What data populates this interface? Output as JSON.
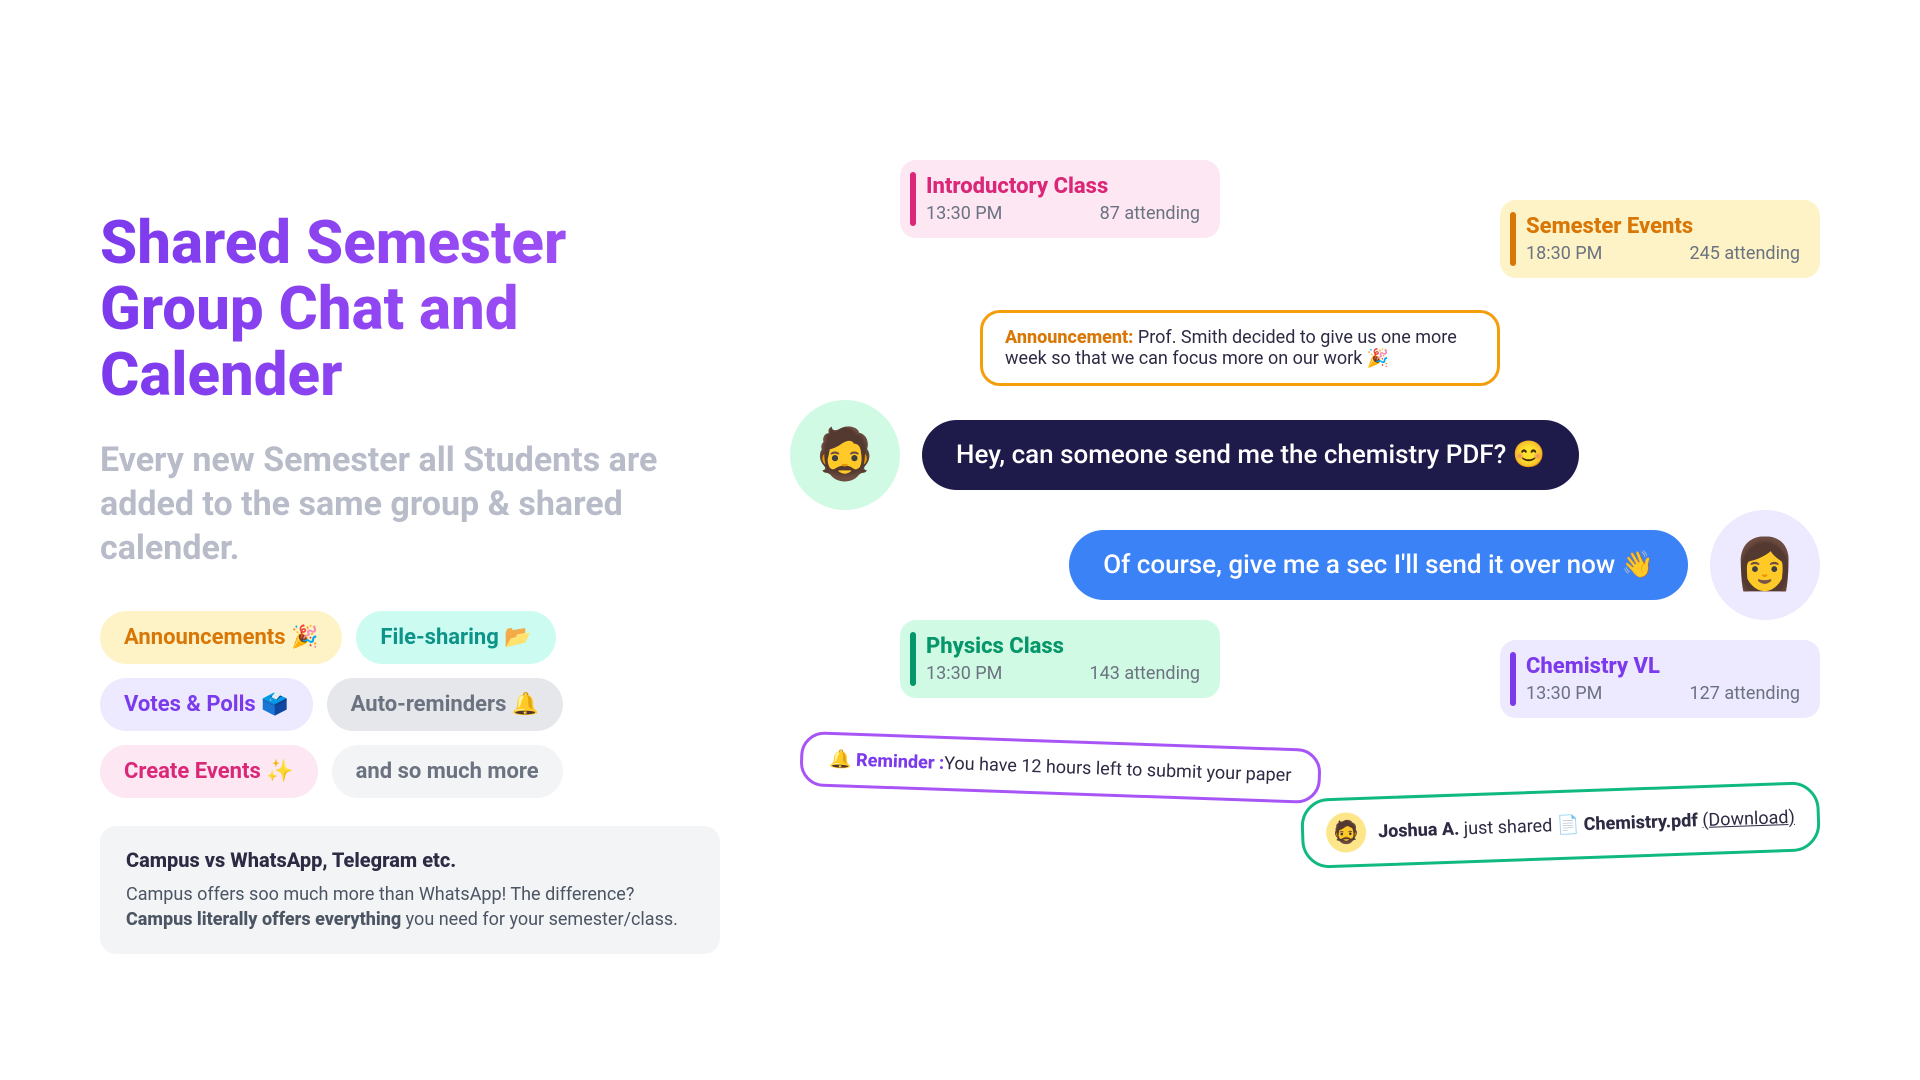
{
  "left": {
    "headline": "Shared Semester Group Chat and Calender",
    "subhead": "Every new Semester all Students are added to the same group & shared calender.",
    "tags": [
      {
        "label": "Announcements 🎉",
        "cls": "tag-yellow"
      },
      {
        "label": "File-sharing 📂",
        "cls": "tag-teal"
      },
      {
        "label": "Votes & Polls 🗳️",
        "cls": "tag-purple"
      },
      {
        "label": "Auto-reminders 🔔",
        "cls": "tag-gray"
      },
      {
        "label": "Create Events ✨",
        "cls": "tag-pink"
      },
      {
        "label": "and so much more",
        "cls": "tag-light"
      }
    ],
    "compare": {
      "title": "Campus vs WhatsApp, Telegram etc.",
      "pre": "Campus offers soo much more than WhatsApp! The difference? ",
      "bold": "Campus literally offers everything",
      "post": " you need for your semester/class."
    }
  },
  "events": {
    "intro": {
      "title": "Introductory Class",
      "time": "13:30 PM",
      "att": "87 attending"
    },
    "sem": {
      "title": "Semester Events",
      "time": "18:30 PM",
      "att": "245 attending"
    },
    "physics": {
      "title": "Physics Class",
      "time": "13:30 PM",
      "att": "143 attending"
    },
    "chem": {
      "title": "Chemistry VL",
      "time": "13:30 PM",
      "att": "127 attending"
    }
  },
  "announcement": {
    "label": "Announcement:",
    "body": " Prof. Smith decided to give us one more week so that we can focus more on our work 🎉"
  },
  "chat": {
    "msg1": "Hey, can someone send me the chemistry PDF? 😊",
    "msg2": "Of course, give me a sec I'll send it over now 👋"
  },
  "reminder": {
    "icon": "🔔",
    "label": "Reminder :",
    "body": "You have 12 hours left to submit your paper"
  },
  "share": {
    "user": "Joshua A.",
    "verb": " just shared ",
    "icon": "📄 ",
    "file": "Chemistry.pdf",
    "dl": "(Download)"
  },
  "avatars": {
    "male": "🧔",
    "female": "👩"
  }
}
